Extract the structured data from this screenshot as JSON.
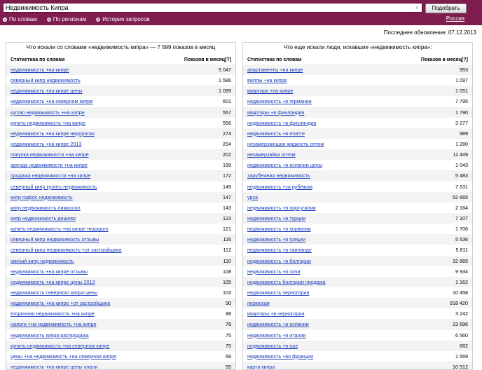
{
  "search": {
    "query": "Недвижимость Кипра",
    "button": "Подобрать",
    "clear": "×"
  },
  "modes": [
    {
      "label": "По словам",
      "selected": true
    },
    {
      "label": "По регионам",
      "selected": false
    },
    {
      "label": "История запросов",
      "selected": false
    }
  ],
  "region": "Россия",
  "updated": "Последнее обновление: 07.12.2013",
  "left": {
    "title": "Что искали со словами «недвижимость кипра» — 7 599 показов в месяц",
    "col_phrase": "Статистика по словам",
    "col_count": "Показов в месяц[?]",
    "rows": [
      {
        "phrase": "недвижимость +на кипре",
        "count": "5 047"
      },
      {
        "phrase": "северный кипр недвижимость",
        "count": "1 586"
      },
      {
        "phrase": "недвижимость +на кипре цены",
        "count": "1 099"
      },
      {
        "phrase": "недвижимость +на северном кипре",
        "count": "601"
      },
      {
        "phrase": "куплю недвижимость +на кипре",
        "count": "557"
      },
      {
        "phrase": "купить недвижимость +на кипре",
        "count": "556"
      },
      {
        "phrase": "недвижимость +на кипре недорогая",
        "count": "274"
      },
      {
        "phrase": "недвижимость +на кипре 2013",
        "count": "204"
      },
      {
        "phrase": "покупка недвижимости +на кипре",
        "count": "202"
      },
      {
        "phrase": "аренда недвижимости +на кипре",
        "count": "199"
      },
      {
        "phrase": "продажа недвижимости +на кипре",
        "count": "172"
      },
      {
        "phrase": "северный кипр купить недвижимость",
        "count": "149"
      },
      {
        "phrase": "кипр пафос недвижимость",
        "count": "147"
      },
      {
        "phrase": "кипр недвижимость лимассол",
        "count": "143"
      },
      {
        "phrase": "кипр недвижимость дешево",
        "count": "123"
      },
      {
        "phrase": "купить недвижимость +на кипре недорого",
        "count": "121"
      },
      {
        "phrase": "северный кипр недвижимость отзывы",
        "count": "116"
      },
      {
        "phrase": "северный кипр недвижимость +от застройщика",
        "count": "112"
      },
      {
        "phrase": "южный кипр недвижимость",
        "count": "110"
      },
      {
        "phrase": "недвижимость +на кипре отзывы",
        "count": "108"
      },
      {
        "phrase": "недвижимость +на кипре цены 2013",
        "count": "105"
      },
      {
        "phrase": "недвижимость северного кипра цены",
        "count": "103"
      },
      {
        "phrase": "недвижимость +на кипре +от застройщика",
        "count": "90"
      },
      {
        "phrase": "вторичная недвижимость +на кипре",
        "count": "88"
      },
      {
        "phrase": "налоги +на недвижимость +на кипре",
        "count": "78"
      },
      {
        "phrase": "недвижимость кипра распродажа",
        "count": "75"
      },
      {
        "phrase": "купить недвижимость +на северном кипре",
        "count": "75"
      },
      {
        "phrase": "цены +на недвижимость +на северном кипре",
        "count": "68"
      },
      {
        "phrase": "недвижимость +на кипре цены упали",
        "count": "55"
      }
    ]
  },
  "right": {
    "title": "Что еще искали люди, искавшие «недвижимость кипра»:",
    "col_phrase": "Статистика по словам",
    "col_count": "Показов в месяц[?]",
    "rows": [
      {
        "phrase": "апартаменты +на кипре",
        "count": "953"
      },
      {
        "phrase": "виллы +на кипре",
        "count": "1 097"
      },
      {
        "phrase": "квартира +на кипре",
        "count": "1 051"
      },
      {
        "phrase": "недвижимость +в германии",
        "count": "7 795"
      },
      {
        "phrase": "квартиры +в финляндии",
        "count": "1 790"
      },
      {
        "phrase": "недвижимость +в финляндии",
        "count": "3 277"
      },
      {
        "phrase": "недвижимость +в египте",
        "count": "989"
      },
      {
        "phrase": "незамерзающая жидкость оптом",
        "count": "1 280"
      },
      {
        "phrase": "незамерзайка оптом",
        "count": "11 449"
      },
      {
        "phrase": "недвижимость +в испании цены",
        "count": "1 043"
      },
      {
        "phrase": "зарубежная недвижимость",
        "count": "5 483"
      },
      {
        "phrase": "недвижимость +за рубежом",
        "count": "7 631"
      },
      {
        "phrase": "урса",
        "count": "52 665"
      },
      {
        "phrase": "недвижимость +в португалии",
        "count": "2 164"
      },
      {
        "phrase": "недвижимость +в турции",
        "count": "7 107"
      },
      {
        "phrase": "недвижимость +в хорватии",
        "count": "1 706"
      },
      {
        "phrase": "недвижимость +в греции",
        "count": "5 536"
      },
      {
        "phrase": "недвижимость +в таиланде",
        "count": "5 811"
      },
      {
        "phrase": "недвижимость +в болгарии",
        "count": "32 865"
      },
      {
        "phrase": "недвижимость +в сочи",
        "count": "9 934"
      },
      {
        "phrase": "недвижимость болгарии продажа",
        "count": "1 162"
      },
      {
        "phrase": "недвижимость черногории",
        "count": "10 458"
      },
      {
        "phrase": "пермская",
        "count": "918 420"
      },
      {
        "phrase": "квартиры +в черногории",
        "count": "3 242"
      },
      {
        "phrase": "недвижимость +в испании",
        "count": "23 696"
      },
      {
        "phrase": "недвижимость +в италии",
        "count": "6 560"
      },
      {
        "phrase": "недвижимость +в оаэ",
        "count": "682"
      },
      {
        "phrase": "недвижимость +во франции",
        "count": "1 569"
      },
      {
        "phrase": "карта кипра",
        "count": "10 512"
      }
    ]
  }
}
